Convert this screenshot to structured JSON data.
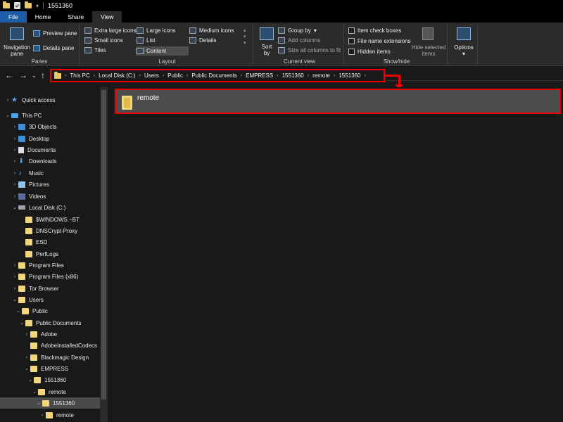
{
  "window": {
    "title": "1551360"
  },
  "tabs": [
    {
      "label": "File"
    },
    {
      "label": "Home"
    },
    {
      "label": "Share"
    },
    {
      "label": "View"
    }
  ],
  "ribbon": {
    "panes": {
      "label": "Panes",
      "navigation_pane": "Navigation pane",
      "preview_pane": "Preview pane",
      "details_pane": "Details pane"
    },
    "layout": {
      "label": "Layout",
      "extra_large_icons": "Extra large icons",
      "large_icons": "Large icons",
      "medium_icons": "Medium icons",
      "small_icons": "Small icons",
      "list": "List",
      "details": "Details",
      "tiles": "Tiles",
      "content": "Content",
      "selected": "Content"
    },
    "current_view": {
      "label": "Current view",
      "sort_by": "Sort by",
      "group_by": "Group by",
      "add_columns": "Add columns",
      "size_columns": "Size all columns to fit"
    },
    "show_hide": {
      "label": "Show/hide",
      "item_check_boxes": "Item check boxes",
      "file_name_extensions": "File name extensions",
      "hidden_items": "Hidden items",
      "hide_selected": "Hide selected items"
    },
    "options": {
      "label": "Options"
    }
  },
  "address_bar": {
    "crumbs": [
      "This PC",
      "Local Disk (C:)",
      "Users",
      "Public",
      "Public Documents",
      "EMPRESS",
      "1551360",
      "remote",
      "1551360"
    ]
  },
  "nav_tree": [
    {
      "label": "Quick access",
      "icon": "star-icon"
    },
    {
      "label": "This PC",
      "icon": "pc-icon"
    },
    {
      "label": "3D Objects",
      "icon": "folder-icon"
    },
    {
      "label": "Desktop",
      "icon": "desktop-icon"
    },
    {
      "label": "Documents",
      "icon": "documents-icon"
    },
    {
      "label": "Downloads",
      "icon": "download-icon"
    },
    {
      "label": "Music",
      "icon": "music-icon"
    },
    {
      "label": "Pictures",
      "icon": "pictures-icon"
    },
    {
      "label": "Videos",
      "icon": "videos-icon"
    },
    {
      "label": "Local Disk (C:)",
      "icon": "drive-icon"
    },
    {
      "label": "$WINDOWS.~BT",
      "icon": "folder-icon"
    },
    {
      "label": "DNSCrypt-Proxy",
      "icon": "folder-icon"
    },
    {
      "label": "ESD",
      "icon": "folder-icon"
    },
    {
      "label": "PerfLogs",
      "icon": "folder-icon"
    },
    {
      "label": "Program Files",
      "icon": "folder-icon"
    },
    {
      "label": "Program Files (x86)",
      "icon": "folder-icon"
    },
    {
      "label": "Tor Browser",
      "icon": "folder-icon"
    },
    {
      "label": "Users",
      "icon": "folder-icon"
    },
    {
      "label": "Public",
      "icon": "folder-icon"
    },
    {
      "label": "Public Documents",
      "icon": "folder-icon"
    },
    {
      "label": "Adobe",
      "icon": "folder-icon"
    },
    {
      "label": "AdobeInstalledCodecs",
      "icon": "folder-icon"
    },
    {
      "label": "Blackmagic Design",
      "icon": "folder-icon"
    },
    {
      "label": "EMPRESS",
      "icon": "folder-icon"
    },
    {
      "label": "1551360",
      "icon": "folder-icon"
    },
    {
      "label": "remote",
      "icon": "folder-icon"
    },
    {
      "label": "1551360",
      "icon": "folder-icon",
      "selected": true
    },
    {
      "label": "remote",
      "icon": "folder-icon"
    }
  ],
  "content": {
    "items": [
      {
        "name": "remote",
        "icon": "folder-icon"
      }
    ]
  },
  "colors": {
    "highlight": "#e00000",
    "file_tab": "#1c5fa8",
    "background": "#191919"
  }
}
